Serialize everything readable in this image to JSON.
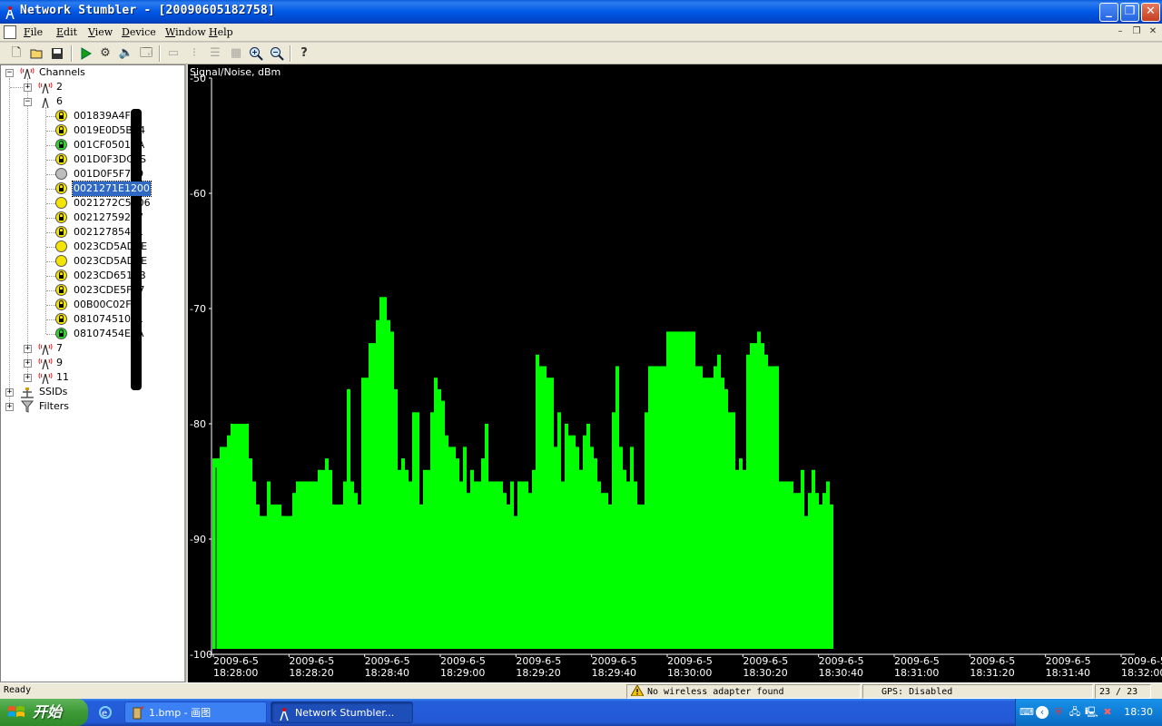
{
  "window": {
    "title": "Network Stumbler - [20090605182758]",
    "buttons": [
      "minimize",
      "maximize",
      "close"
    ]
  },
  "menubar": {
    "items": [
      "File",
      "Edit",
      "View",
      "Device",
      "Window",
      "Help"
    ]
  },
  "toolbar": {
    "icons": [
      "new-icon",
      "open-icon",
      "save-icon",
      "play-icon",
      "auto-config-icon",
      "mute-icon",
      "properties-icon",
      "large-icons-icon",
      "small-icons-icon",
      "list-icon",
      "details-icon",
      "zoom-in-icon",
      "zoom-out-icon",
      "help-icon"
    ]
  },
  "tree": {
    "root": "Channels",
    "channels": [
      "2",
      "6",
      "7",
      "9",
      "11"
    ],
    "aps": [
      {
        "label": "001839A4FF1",
        "status": "lock-yellow"
      },
      {
        "label": "0019E0D5B84",
        "status": "lock-yellow"
      },
      {
        "label": "001CF0501CA",
        "status": "lock-green"
      },
      {
        "label": "001D0F3DC1S",
        "status": "lock-yellow"
      },
      {
        "label": "001D0F5F799",
        "status": "grey"
      },
      {
        "label": "0021271E1200",
        "status": "lock-yellow",
        "selected": true
      },
      {
        "label": "0021272C5006",
        "status": "yellow"
      },
      {
        "label": "00212759277",
        "status": "lock-yellow"
      },
      {
        "label": "00212785491",
        "status": "lock-yellow"
      },
      {
        "label": "0023CD5AD3E",
        "status": "yellow"
      },
      {
        "label": "0023CD5AD7E",
        "status": "yellow"
      },
      {
        "label": "0023CD6512B",
        "status": "lock-yellow"
      },
      {
        "label": "0023CDE5F87",
        "status": "lock-yellow"
      },
      {
        "label": "00B00C02F6",
        "status": "lock-yellow"
      },
      {
        "label": "08107451051",
        "status": "lock-yellow"
      },
      {
        "label": "08107454E5A",
        "status": "lock-green"
      }
    ],
    "ssids_label": "SSIDs",
    "filters_label": "Filters"
  },
  "chart_data": {
    "type": "area",
    "ylabel": "Signal/Noise, dBm",
    "ylim": [
      -100,
      -50
    ],
    "yticks": [
      "-50",
      "-60",
      "-70",
      "-80",
      "-90",
      "-100"
    ],
    "xticks": [
      {
        "date": "2009-6-5",
        "time": "18:28:00"
      },
      {
        "date": "2009-6-5",
        "time": "18:28:20"
      },
      {
        "date": "2009-6-5",
        "time": "18:28:40"
      },
      {
        "date": "2009-6-5",
        "time": "18:29:00"
      },
      {
        "date": "2009-6-5",
        "time": "18:29:20"
      },
      {
        "date": "2009-6-5",
        "time": "18:29:40"
      },
      {
        "date": "2009-6-5",
        "time": "18:30:00"
      },
      {
        "date": "2009-6-5",
        "time": "18:30:20"
      },
      {
        "date": "2009-6-5",
        "time": "18:30:40"
      },
      {
        "date": "2009-6-5",
        "time": "18:31:00"
      },
      {
        "date": "2009-6-5",
        "time": "18:31:20"
      },
      {
        "date": "2009-6-5",
        "time": "18:31:40"
      },
      {
        "date": "2009-6-5",
        "time": "18:32:00"
      }
    ],
    "series": [
      {
        "color": "#00ff00",
        "values": [
          -83,
          -83,
          -82,
          -82,
          -81,
          -80,
          -80,
          -80,
          -80,
          -80,
          -83,
          -85,
          -87,
          -88,
          -88,
          -85,
          -87,
          -87,
          -87,
          -88,
          -88,
          -88,
          -86,
          -85,
          -85,
          -85,
          -85,
          -85,
          -85,
          -84,
          -84,
          -83,
          -84,
          -87,
          -87,
          -87,
          -85,
          -77,
          -85,
          -86,
          -87,
          -76,
          -76,
          -73,
          -73,
          -71,
          -69,
          -69,
          -71,
          -72,
          -77,
          -84,
          -83,
          -84,
          -85,
          -79,
          -79,
          -87,
          -84,
          -84,
          -79,
          -76,
          -77,
          -78,
          -81,
          -82,
          -82,
          -83,
          -85,
          -82,
          -86,
          -84,
          -85,
          -85,
          -83,
          -80,
          -85,
          -85,
          -85,
          -85,
          -86,
          -87,
          -85,
          -88,
          -85,
          -85,
          -85,
          -86,
          -84,
          -74,
          -75,
          -75,
          -76,
          -76,
          -82,
          -79,
          -85,
          -80,
          -81,
          -81,
          -82,
          -84,
          -81,
          -80,
          -82,
          -83,
          -85,
          -86,
          -86,
          -87,
          -79,
          -75,
          -82,
          -84,
          -85,
          -82,
          -85,
          -87,
          -87,
          -79,
          -75,
          -75,
          -75,
          -75,
          -75,
          -72,
          -72,
          -72,
          -72,
          -72,
          -72,
          -72,
          -72,
          -75,
          -75,
          -76,
          -76,
          -76,
          -75,
          -74,
          -76,
          -77,
          -79,
          -79,
          -84,
          -83,
          -84,
          -74,
          -73,
          -73,
          -72,
          -73,
          -74,
          -75,
          -75,
          -75,
          -85,
          -85,
          -85,
          -85,
          -86,
          -86,
          -84,
          -88,
          -86,
          -84,
          -86,
          -87,
          -86,
          -85,
          -87
        ]
      }
    ],
    "grid": false
  },
  "statusbar": {
    "ready": "Ready",
    "adapter": "No wireless adapter found",
    "gps": "GPS: Disabled",
    "count": "23 / 23"
  },
  "taskbar": {
    "start_label": "开始",
    "tasks": [
      {
        "label": "1.bmp - 画图",
        "active": false
      },
      {
        "label": "Network Stumbler...",
        "active": true
      }
    ],
    "clock": "18:30"
  }
}
